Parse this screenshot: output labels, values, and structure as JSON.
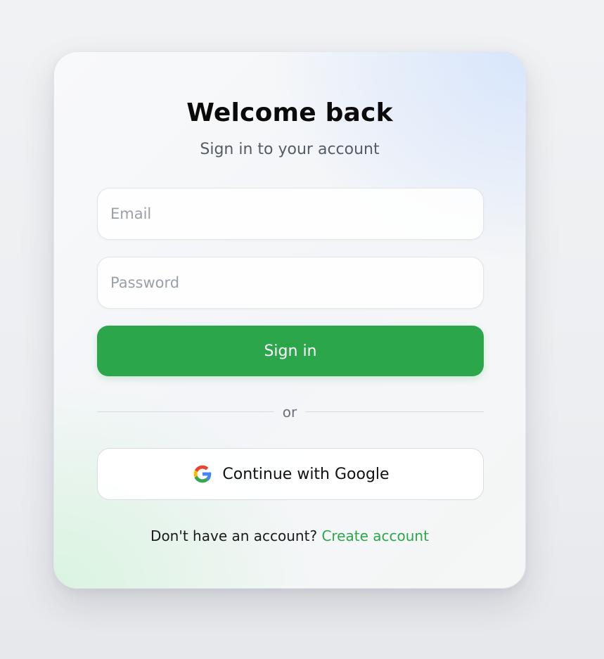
{
  "header": {
    "title": "Welcome back",
    "subtitle": "Sign in to your account"
  },
  "form": {
    "email_placeholder": "Email",
    "email_value": "",
    "password_placeholder": "Password",
    "password_value": "",
    "signin_label": "Sign in"
  },
  "divider": {
    "text": "or"
  },
  "google": {
    "label": "Continue with Google",
    "icon": "google-logo-icon"
  },
  "footer": {
    "prompt": "Don't have an account?",
    "link_label": "Create account"
  },
  "colors": {
    "accent": "#2ca64a",
    "page_background": "#eeeff2",
    "google_blue": "#4285F4",
    "google_red": "#EA4335",
    "google_yellow": "#FBBC05",
    "google_green": "#34A853"
  }
}
